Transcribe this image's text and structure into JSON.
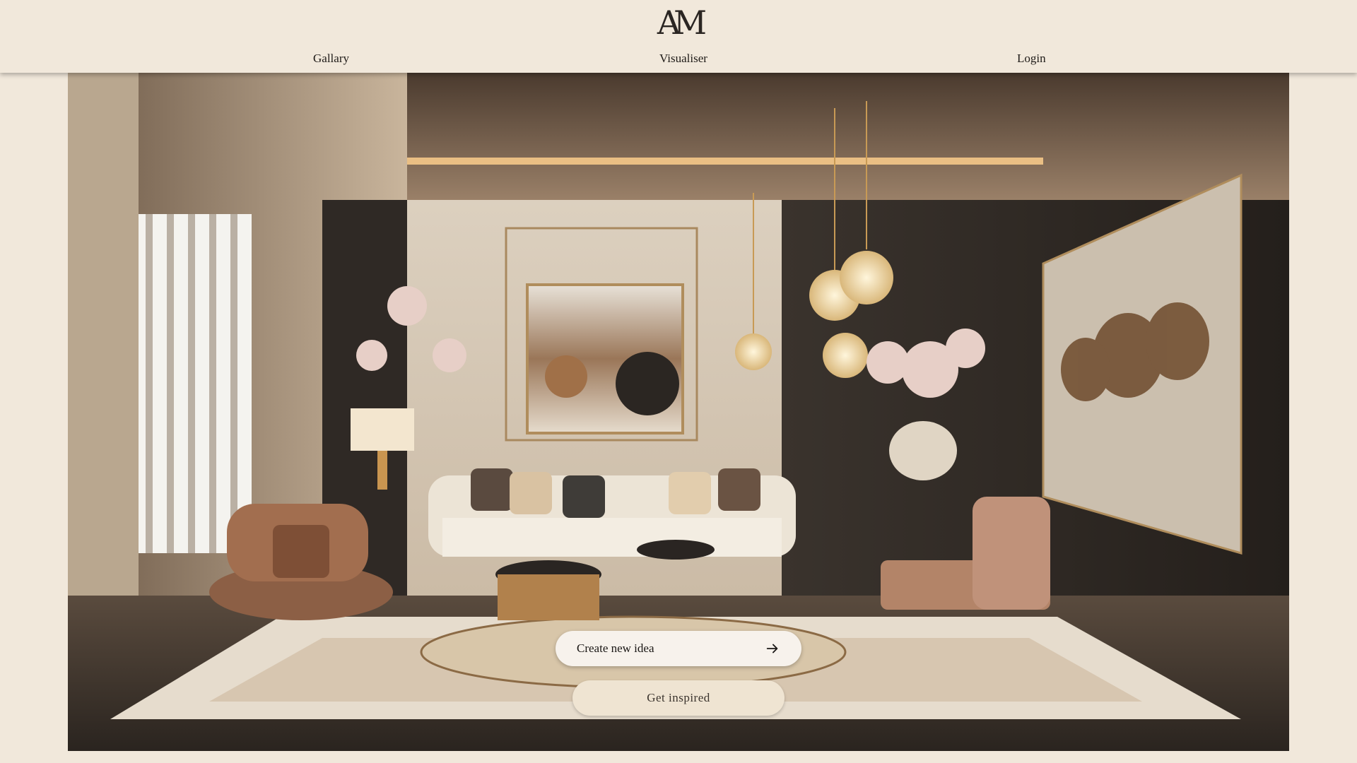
{
  "header": {
    "logo_text": "AM",
    "nav": {
      "gallery": "Gallary",
      "visualiser": "Visualiser",
      "login": "Login"
    }
  },
  "hero": {
    "image_subject": "luxury-living-room-interior",
    "create_button": {
      "label": "Create new idea",
      "icon": "arrow-right-icon"
    },
    "inspired_button": {
      "label": "Get inspired"
    }
  },
  "colors": {
    "background": "#f1e8db",
    "button_light": "#f7f2ec",
    "button_beige": "#efe4d2",
    "text_dark": "#1f1b18"
  }
}
